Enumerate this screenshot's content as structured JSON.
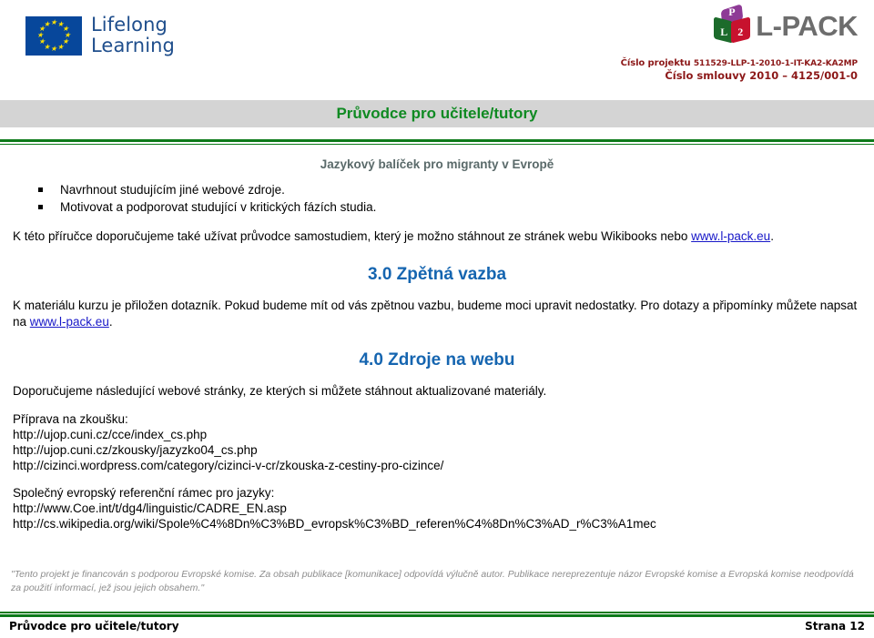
{
  "header": {
    "eu_logo": {
      "name": "eu-lifelong-learning-logo",
      "line1": "Lifelong",
      "line2": "Learning"
    },
    "lpack_logo": {
      "cube_top_letter": "P",
      "cube_left_letter": "L",
      "cube_right_letter": "2",
      "wordmark": "L-PACK",
      "colors": {
        "cube_top": "#8e3a96",
        "cube_left": "#1c6b2b",
        "cube_right": "#c7122e",
        "wordmark": "#6d6d6d"
      }
    },
    "project_info": {
      "label_project": "Číslo projektu",
      "number_project": "511529-LLP-1-2010-1-IT-KA2-KA2MP",
      "line_contract": "Číslo smlouvy 2010 – 4125/001-0",
      "color": "#8c1818"
    }
  },
  "title_band": {
    "title": "Průvodce pro učitele/tutory",
    "band_color": "#d4d4d4",
    "title_color": "#0f8a22",
    "rule_color": "#0d7a1a"
  },
  "subtitle": "Jazykový balíček pro migranty v Evropě",
  "bullets": [
    "Navrhnout studujícím jiné webové zdroje.",
    "Motivovat a podporovat studující v kritických fázích studia."
  ],
  "intro_paragraph": {
    "text_before": "K této příručce doporučujeme také užívat průvodce samostudiem, který je možno stáhnout ze stránek webu Wikibooks nebo",
    "link": "www.l-pack.eu",
    "text_after": "."
  },
  "section_feedback": {
    "heading": "3.0 Zpětná vazba",
    "paragraph_before": "K materiálu kurzu je přiložen dotazník. Pokud budeme mít od vás zpětnou vazbu, budeme moci upravit nedostatky. Pro dotazy a připomínky můžete napsat na",
    "link": "www.l-pack.eu",
    "paragraph_after": "."
  },
  "section_resources": {
    "heading": "4.0 Zdroje na webu",
    "intro": "Doporučujeme následující webové stránky, ze kterých si můžete stáhnout aktualizované materiály.",
    "groups": [
      {
        "label": "Příprava na zkoušku:",
        "urls": [
          "http://ujop.cuni.cz/cce/index_cs.php",
          "http://ujop.cuni.cz/zkousky/jazyzko04_cs.php",
          "http://cizinci.wordpress.com/category/cizinci-v-cr/zkouska-z-cestiny-pro-cizince/"
        ]
      },
      {
        "label": "Společný evropský referenční rámec pro jazyky:",
        "urls": [
          "http://www.Coe.int/t/dg4/linguistic/CADRE_EN.asp",
          "http://cs.wikipedia.org/wiki/Spole%C4%8Dn%C3%BD_evropsk%C3%BD_referen%C4%8Dn%C3%AD_r%C3%A1mec"
        ]
      }
    ]
  },
  "disclaimer": "\"Tento projekt je financován s podporou Evropské komise.  Za obsah publikace [komunikace] odpovídá výlučně autor. Publikace nereprezentuje názor Evropské komise a Evropská komise neodpovídá za použití informací, jež jsou jejich obsahem.\"",
  "footer": {
    "left": "Průvodce pro učitele/tutory",
    "right": "Strana 12"
  }
}
